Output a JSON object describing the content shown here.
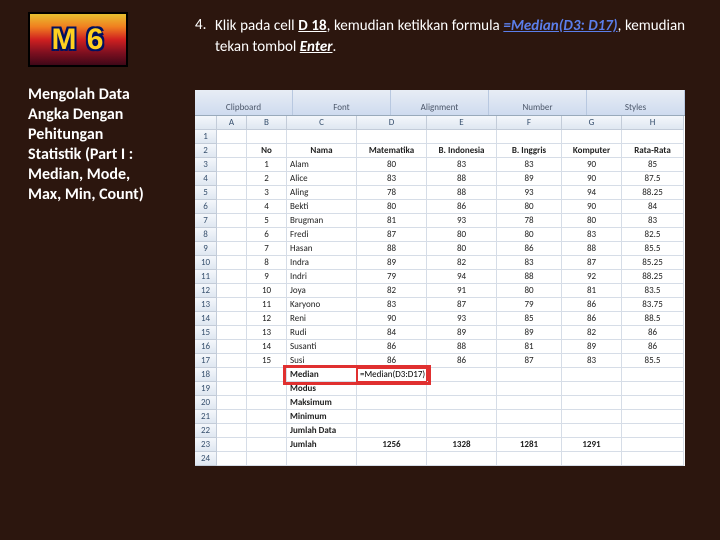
{
  "badge": "M 6",
  "desc": "Mengolah Data Angka Dengan Pehitungan Statistik (Part I : Median, Mode, Max, Min, Count)",
  "instr": {
    "num": "4.",
    "t1": "Klik pada cell ",
    "d18": "D 18",
    "t2": ", kemudian ketikkan formula ",
    "formula": "=Median(D3: D17)",
    "t3": ", kemudian tekan tombol ",
    "enter": "Enter",
    "dot": "."
  },
  "ribbon": [
    "Clipboard",
    "Font",
    "Alignment",
    "Number",
    "Styles"
  ],
  "cols": [
    "",
    "A",
    "B",
    "C",
    "D",
    "E",
    "F",
    "G",
    "H"
  ],
  "headers": [
    "No",
    "Nama",
    "Matematika",
    "B. Indonesia",
    "B. Inggris",
    "Komputer",
    "Rata-Rata"
  ],
  "rows": [
    {
      "r": "3",
      "no": "1",
      "nm": "Alam",
      "d": "80",
      "e": "83",
      "f": "83",
      "g": "90",
      "h": "85"
    },
    {
      "r": "4",
      "no": "2",
      "nm": "Alice",
      "d": "83",
      "e": "88",
      "f": "89",
      "g": "90",
      "h": "87.5"
    },
    {
      "r": "5",
      "no": "3",
      "nm": "Aling",
      "d": "78",
      "e": "88",
      "f": "93",
      "g": "94",
      "h": "88.25"
    },
    {
      "r": "6",
      "no": "4",
      "nm": "Bekti",
      "d": "80",
      "e": "86",
      "f": "80",
      "g": "90",
      "h": "84"
    },
    {
      "r": "7",
      "no": "5",
      "nm": "Brugman",
      "d": "81",
      "e": "93",
      "f": "78",
      "g": "80",
      "h": "83"
    },
    {
      "r": "8",
      "no": "6",
      "nm": "Fredi",
      "d": "87",
      "e": "80",
      "f": "80",
      "g": "83",
      "h": "82.5"
    },
    {
      "r": "9",
      "no": "7",
      "nm": "Hasan",
      "d": "88",
      "e": "80",
      "f": "86",
      "g": "88",
      "h": "85.5"
    },
    {
      "r": "10",
      "no": "8",
      "nm": "Indra",
      "d": "89",
      "e": "82",
      "f": "83",
      "g": "87",
      "h": "85.25"
    },
    {
      "r": "11",
      "no": "9",
      "nm": "Indri",
      "d": "79",
      "e": "94",
      "f": "88",
      "g": "92",
      "h": "88.25"
    },
    {
      "r": "12",
      "no": "10",
      "nm": "Joya",
      "d": "82",
      "e": "91",
      "f": "80",
      "g": "81",
      "h": "83.5"
    },
    {
      "r": "13",
      "no": "11",
      "nm": "Karyono",
      "d": "83",
      "e": "87",
      "f": "79",
      "g": "86",
      "h": "83.75"
    },
    {
      "r": "14",
      "no": "12",
      "nm": "Reni",
      "d": "90",
      "e": "93",
      "f": "85",
      "g": "86",
      "h": "88.5"
    },
    {
      "r": "15",
      "no": "13",
      "nm": "Rudi",
      "d": "84",
      "e": "89",
      "f": "89",
      "g": "82",
      "h": "86"
    },
    {
      "r": "16",
      "no": "14",
      "nm": "Susanti",
      "d": "86",
      "e": "88",
      "f": "81",
      "g": "89",
      "h": "86"
    },
    {
      "r": "17",
      "no": "15",
      "nm": "Susi",
      "d": "86",
      "e": "86",
      "f": "87",
      "g": "83",
      "h": "85.5"
    }
  ],
  "summary": [
    {
      "r": "18",
      "label": "Median",
      "formula": "=Median(D3:D17)"
    },
    {
      "r": "19",
      "label": "Modus"
    },
    {
      "r": "20",
      "label": "Maksimum"
    },
    {
      "r": "21",
      "label": "Minimum"
    },
    {
      "r": "22",
      "label": "Jumlah Data"
    },
    {
      "r": "23",
      "label": "Jumlah",
      "d": "1256",
      "e": "1328",
      "f": "1281",
      "g": "1291"
    }
  ],
  "row1": "1",
  "row2": "2",
  "row24": "24"
}
